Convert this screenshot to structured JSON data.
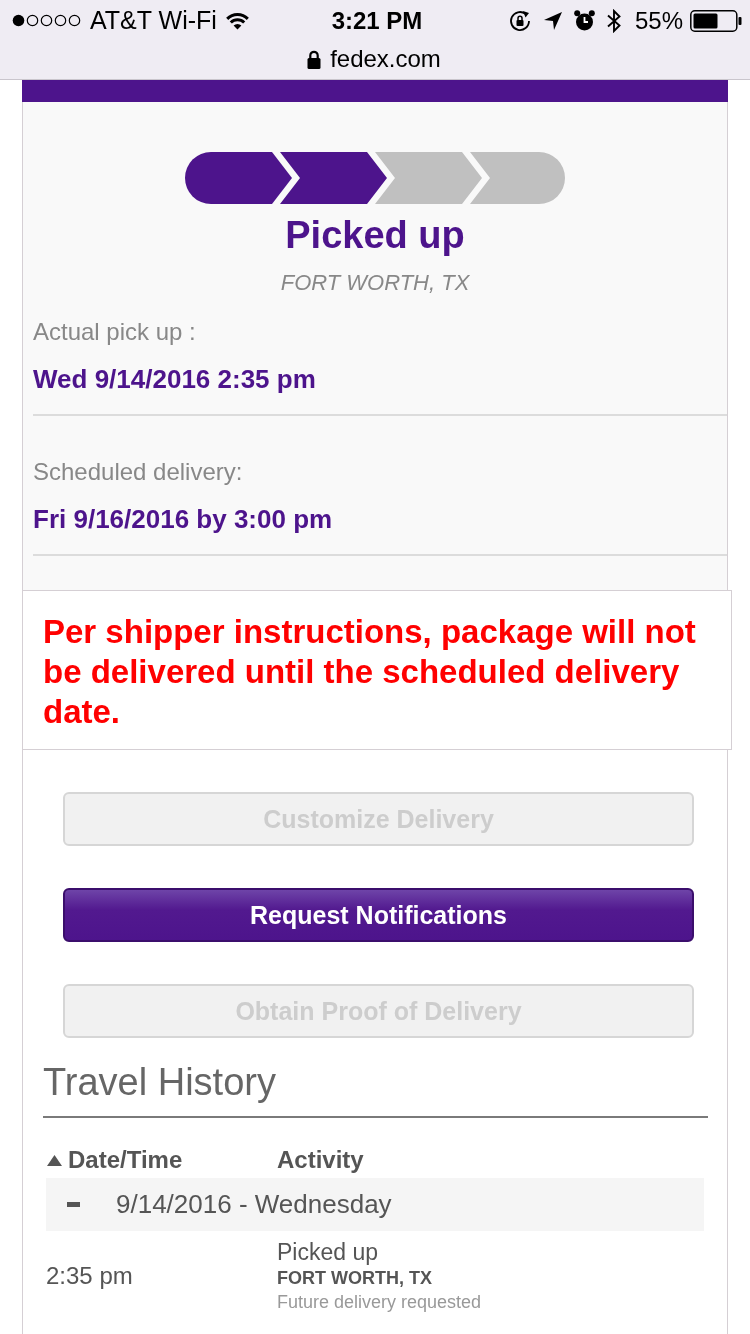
{
  "browser_status_bar": {
    "carrier": "AT&T Wi-Fi",
    "time": "3:21 PM",
    "battery": "55%"
  },
  "address_bar": {
    "url": "fedex.com"
  },
  "shipment": {
    "progress_steps": [
      {
        "completed": true
      },
      {
        "completed": true
      },
      {
        "completed": false
      },
      {
        "completed": false
      }
    ],
    "status": "Picked up",
    "location": "FORT WORTH, TX",
    "dates": [
      {
        "label": "Actual pick up :",
        "value": "Wed 9/14/2016 2:35 pm"
      },
      {
        "label": "Scheduled delivery:",
        "value": "Fri 9/16/2016 by 3:00 pm"
      }
    ]
  },
  "notice": {
    "text": "Per shipper instructions, package will not be delivered until the scheduled delivery date."
  },
  "actions": [
    {
      "label": "Customize Delivery",
      "disabled": true
    },
    {
      "label": "Request Notifications",
      "disabled": false
    },
    {
      "label": "Obtain Proof of Delivery",
      "disabled": true
    }
  ],
  "travel_history": {
    "title": "Travel History",
    "columns": [
      {
        "label": "Date/Time",
        "sorted": true
      },
      {
        "label": "Activity",
        "sorted": false
      }
    ],
    "groups": [
      {
        "date": "9/14/2016 - Wednesday",
        "expanded": true,
        "events": [
          {
            "time": "2:35 pm",
            "activity": "Picked up",
            "location": "FORT WORTH, TX",
            "note": "Future delivery requested"
          }
        ]
      }
    ]
  }
}
